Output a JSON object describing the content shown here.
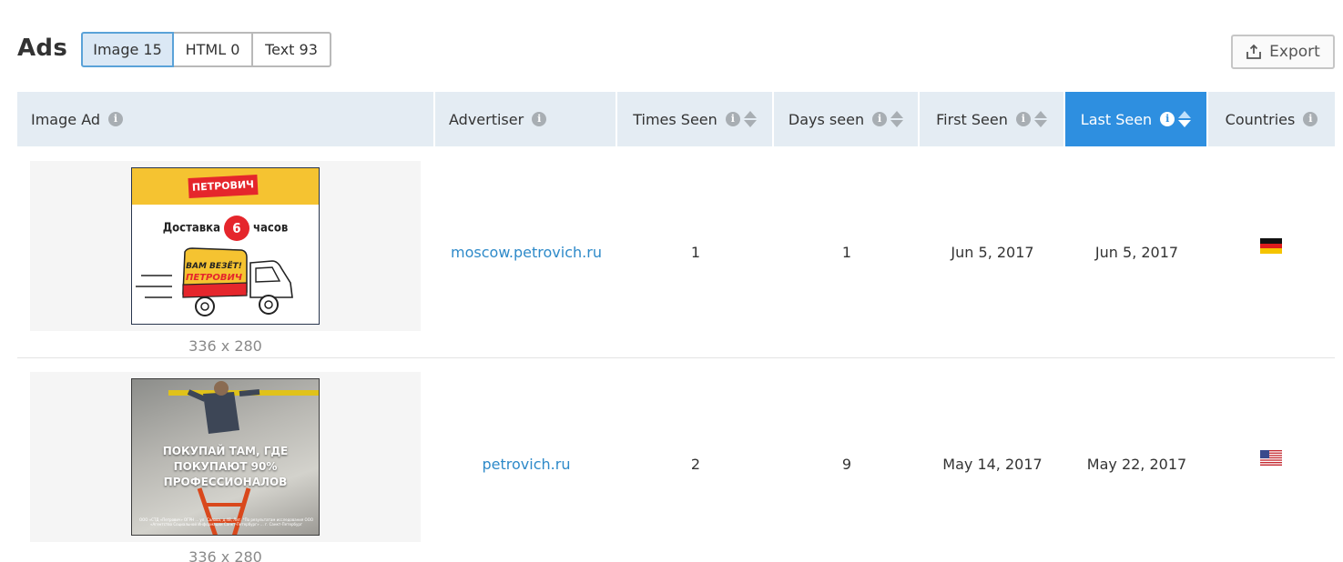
{
  "header": {
    "title": "Ads",
    "tabs": [
      {
        "label": "Image 15",
        "active": true
      },
      {
        "label": "HTML 0",
        "active": false
      },
      {
        "label": "Text 93",
        "active": false
      }
    ],
    "export_label": "Export"
  },
  "table": {
    "columns": [
      {
        "label": "Image Ad",
        "sortable": false
      },
      {
        "label": "Advertiser",
        "sortable": false
      },
      {
        "label": "Times Seen",
        "sortable": true
      },
      {
        "label": "Days seen",
        "sortable": true
      },
      {
        "label": "First Seen",
        "sortable": true
      },
      {
        "label": "Last Seen",
        "sortable": true,
        "active": true
      },
      {
        "label": "Countries",
        "sortable": false
      }
    ],
    "rows": [
      {
        "ad_size": "336 x 280",
        "ad_text": {
          "logo": "ПЕТРОВИЧ",
          "line_pre": "Доставка",
          "number": "6",
          "line_post": "часов",
          "truck_text": "ВАМ ВЕЗЁТ! ПЕТРОВИЧ"
        },
        "advertiser": "moscow.petrovich.ru",
        "times_seen": "1",
        "days_seen": "1",
        "first_seen": "Jun 5, 2017",
        "last_seen": "Jun 5, 2017",
        "country_flag": "germany-flag-icon"
      },
      {
        "ad_size": "336 x 280",
        "ad_text": {
          "caption": "ПОКУПАЙ ТАМ, ГДЕ ПОКУПАЮТ 90% ПРОФЕССИОНАЛОВ",
          "legal": "ООО «СТД «Петрович» ОГРН ... ул. Салова, д.48, Лит. *По результатам исследования ООО «Агентство Социальной Информации Санкт-Петербург» ... г. Санкт-Петербург"
        },
        "advertiser": "petrovich.ru",
        "times_seen": "2",
        "days_seen": "9",
        "first_seen": "May 14, 2017",
        "last_seen": "May 22, 2017",
        "country_flag": "usa-flag-icon"
      }
    ]
  },
  "colors": {
    "accent": "#2e8fe0",
    "header_bg": "#e4ecf3",
    "link": "#2e8ac9",
    "tab_active_bg": "#dbe8f5",
    "ad_yellow": "#f5c331",
    "ad_red": "#e5262c"
  }
}
